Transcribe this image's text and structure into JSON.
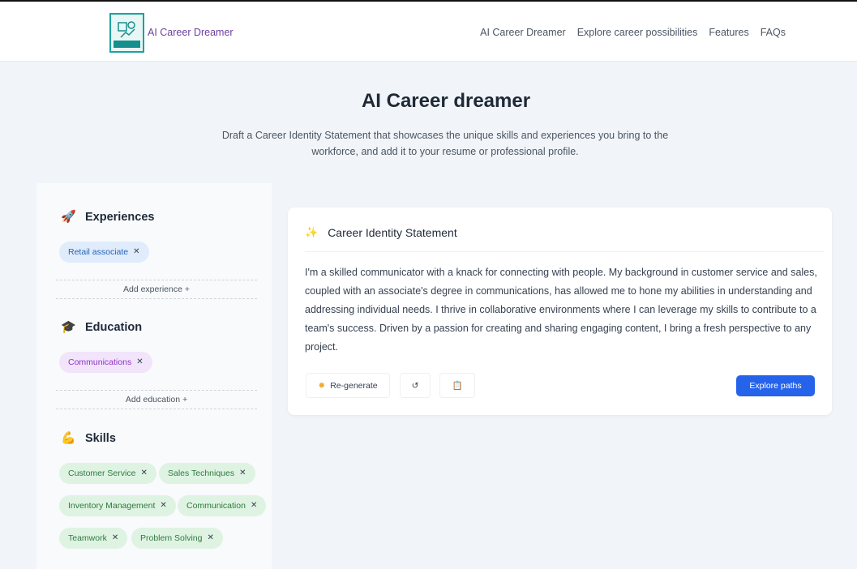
{
  "header": {
    "brand": "AI Career Dreamer",
    "nav": [
      "AI Career Dreamer",
      "Explore career possibilities",
      "Features",
      "FAQs"
    ]
  },
  "hero": {
    "title": "AI Career dreamer",
    "subtitle_line1": "Draft a Career Identity Statement that showcases the unique skills and experiences you bring to the",
    "subtitle_line2": "workforce, and add it to your resume or professional profile."
  },
  "experiences": {
    "title": "Experiences",
    "icon": "rocket-icon",
    "chips": [
      "Retail associate"
    ],
    "add_label": "Add experience +"
  },
  "education": {
    "title": "Education",
    "icon": "graduation-cap-icon",
    "chips": [
      "Communications"
    ],
    "add_label": "Add education +"
  },
  "skills": {
    "title": "Skills",
    "icon": "flexed-biceps-icon",
    "chips": [
      "Customer Service",
      "Sales Techniques",
      "Inventory Management",
      "Communication",
      "Teamwork",
      "Problem Solving"
    ]
  },
  "statement": {
    "title": "Career Identity Statement",
    "text": "I'm a skilled communicator with a knack for connecting with people. My background in customer service and sales, coupled with an associate's degree in communications, has allowed me to hone my abilities in understanding and addressing individual needs. I thrive in collaborative environments where I can leverage my skills to contribute to a team's success. Driven by a passion for creating and sharing engaging content, I bring a fresh perspective to any project.",
    "regenerate_label": "Re-generate",
    "explore_label": "Explore paths"
  },
  "colors": {
    "primary": "#2563eb",
    "brand_text": "#6b3fa0",
    "logo_teal": "#1aa3a0"
  }
}
